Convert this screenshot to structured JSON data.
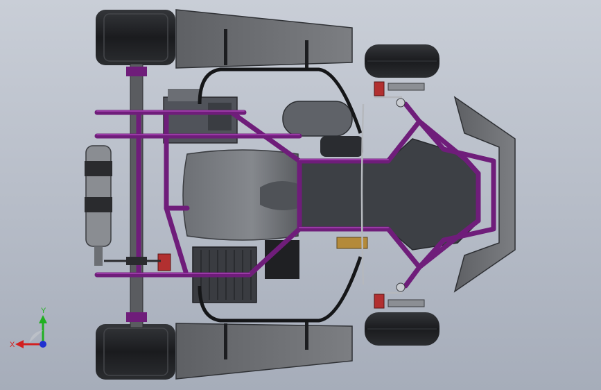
{
  "viewport": {
    "background_top": "#c9ced7",
    "background_bottom": "#a6adba"
  },
  "colors": {
    "frame": "#6f1d7a",
    "frame_highlight": "#9a3aa6",
    "tire": "#1e1f22",
    "tire_highlight": "#3a3c40",
    "bodywork": "#6a6c70",
    "floor": "#3f4247",
    "seat": "#75787d",
    "engine": "#4b4e53",
    "accent_red": "#b23030",
    "accent_gold": "#b48a3a",
    "axis_x": "#d22020",
    "axis_y": "#20b020",
    "axis_z": "#2030d0"
  },
  "triad": {
    "x_label": "X",
    "y_label": "Y"
  }
}
